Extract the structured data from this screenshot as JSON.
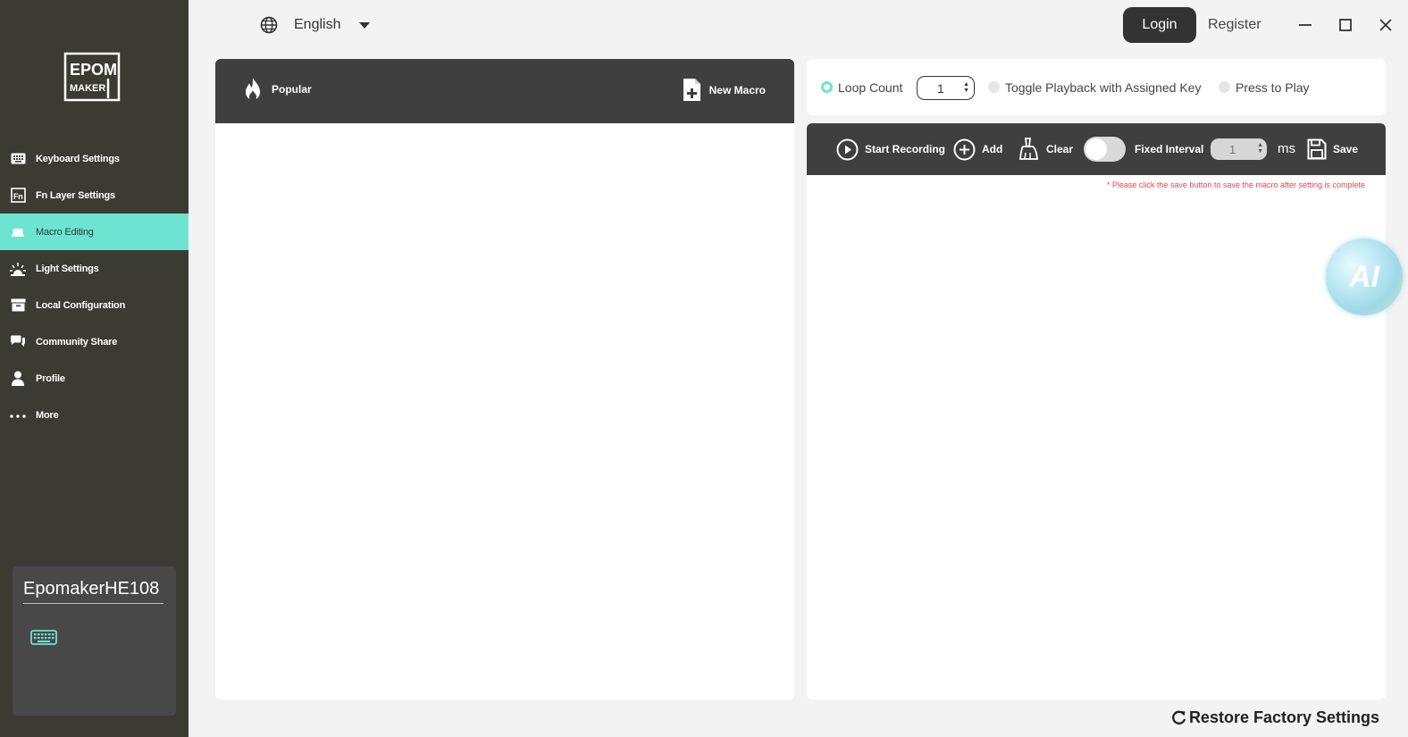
{
  "brand": {
    "logo_lines": [
      "EPOM",
      "MAKER"
    ]
  },
  "sidebar": {
    "items": [
      {
        "label": "Keyboard Settings",
        "icon": "keyboard-icon"
      },
      {
        "label": "Fn Layer Settings",
        "icon": "fn-icon"
      },
      {
        "label": "Macro Editing",
        "icon": "macro-icon",
        "active": true
      },
      {
        "label": "Light Settings",
        "icon": "light-icon"
      },
      {
        "label": "Local Configuration",
        "icon": "archive-icon"
      },
      {
        "label": "Community Share",
        "icon": "chat-icon"
      },
      {
        "label": "Profile",
        "icon": "user-icon"
      },
      {
        "label": "More",
        "icon": "more-icon"
      }
    ],
    "device": {
      "name": "EpomakerHE108",
      "icon": "keyboard-icon"
    }
  },
  "topbar": {
    "language": "English",
    "login_label": "Login",
    "register_label": "Register"
  },
  "macro_list": {
    "popular_label": "Popular",
    "new_macro_label": "New Macro"
  },
  "playback": {
    "loop_count_label": "Loop Count",
    "loop_count_value": "1",
    "toggle_label": "Toggle Playback with Assigned Key",
    "press_label": "Press to Play",
    "selected": "loop_count"
  },
  "toolbar": {
    "start_recording_label": "Start Recording",
    "add_label": "Add",
    "clear_label": "Clear",
    "fixed_interval_label": "Fixed Interval",
    "fixed_interval_on": false,
    "interval_value": "1",
    "ms_label": "ms",
    "save_label": "Save"
  },
  "hint": "* Please click the save button to save the macro after setting is complete",
  "ai_label": "AI",
  "restore_label": "Restore Factory Settings",
  "colors": {
    "accent": "#6de4d2",
    "sidebar": "#3c3b33",
    "panel_header": "#3f3f3f",
    "hint": "#e6454d"
  }
}
